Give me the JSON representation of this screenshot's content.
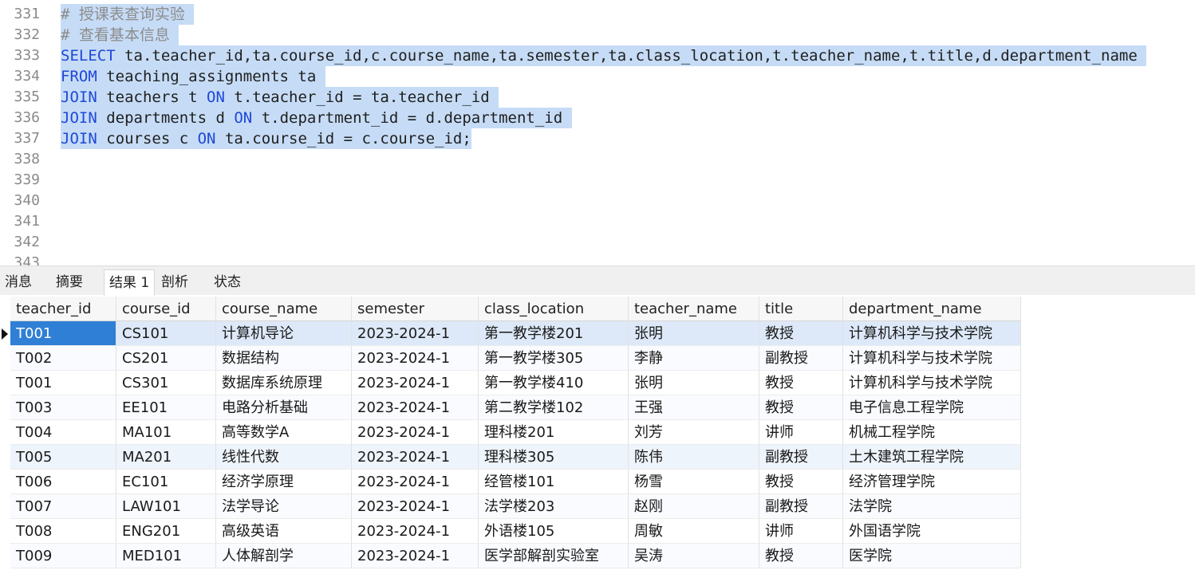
{
  "editor": {
    "lines": [
      {
        "num": "331",
        "segments": [
          {
            "t": "# 授课表查询实验 ",
            "k": "cm"
          }
        ]
      },
      {
        "num": "332",
        "segments": [
          {
            "t": "# 查看基本信息 ",
            "k": "cm"
          }
        ]
      },
      {
        "num": "333",
        "segments": [
          {
            "t": "SELECT",
            "k": "kw"
          },
          {
            "t": " ta.teacher_id,ta.course_id,c.course_name,ta.semester,ta.class_location,t.teacher_name,t.title,d.department_name ",
            "k": ""
          }
        ]
      },
      {
        "num": "334",
        "segments": [
          {
            "t": "FROM",
            "k": "kw"
          },
          {
            "t": " teaching_assignments ta ",
            "k": ""
          }
        ]
      },
      {
        "num": "335",
        "segments": [
          {
            "t": "JOIN",
            "k": "kw"
          },
          {
            "t": " teachers t ",
            "k": ""
          },
          {
            "t": "ON",
            "k": "kw"
          },
          {
            "t": " t.teacher_id = ta.teacher_id ",
            "k": ""
          }
        ]
      },
      {
        "num": "336",
        "segments": [
          {
            "t": "JOIN",
            "k": "kw"
          },
          {
            "t": " departments d ",
            "k": ""
          },
          {
            "t": "ON",
            "k": "kw"
          },
          {
            "t": " t.department_id = d.department_id ",
            "k": ""
          }
        ]
      },
      {
        "num": "337",
        "segments": [
          {
            "t": "JOIN",
            "k": "kw"
          },
          {
            "t": " courses c ",
            "k": ""
          },
          {
            "t": "ON",
            "k": "kw"
          },
          {
            "t": " ta.course_id = c.course_id;",
            "k": ""
          }
        ]
      },
      {
        "num": "338",
        "segments": []
      },
      {
        "num": "339",
        "segments": []
      },
      {
        "num": "340",
        "segments": []
      },
      {
        "num": "341",
        "segments": []
      },
      {
        "num": "342",
        "segments": []
      },
      {
        "num": "343",
        "segments": []
      }
    ]
  },
  "tabs": [
    {
      "label": "消息",
      "active": false
    },
    {
      "label": "摘要",
      "active": false
    },
    {
      "label": "结果 1",
      "active": true
    },
    {
      "label": "剖析",
      "active": false
    },
    {
      "label": "状态",
      "active": false
    }
  ],
  "results": {
    "columns": [
      "teacher_id",
      "course_id",
      "course_name",
      "semester",
      "class_location",
      "teacher_name",
      "title",
      "department_name"
    ],
    "rows": [
      [
        "T001",
        "CS101",
        "计算机导论",
        "2023-2024-1",
        "第一教学楼201",
        "张明",
        "教授",
        "计算机科学与技术学院"
      ],
      [
        "T002",
        "CS201",
        "数据结构",
        "2023-2024-1",
        "第一教学楼305",
        "李静",
        "副教授",
        "计算机科学与技术学院"
      ],
      [
        "T001",
        "CS301",
        "数据库系统原理",
        "2023-2024-1",
        "第一教学楼410",
        "张明",
        "教授",
        "计算机科学与技术学院"
      ],
      [
        "T003",
        "EE101",
        "电路分析基础",
        "2023-2024-1",
        "第二教学楼102",
        "王强",
        "教授",
        "电子信息工程学院"
      ],
      [
        "T004",
        "MA101",
        "高等数学A",
        "2023-2024-1",
        "理科楼201",
        "刘芳",
        "讲师",
        "机械工程学院"
      ],
      [
        "T005",
        "MA201",
        "线性代数",
        "2023-2024-1",
        "理科楼305",
        "陈伟",
        "副教授",
        "土木建筑工程学院"
      ],
      [
        "T006",
        "EC101",
        "经济学原理",
        "2023-2024-1",
        "经管楼101",
        "杨雪",
        "教授",
        "经济管理学院"
      ],
      [
        "T007",
        "LAW101",
        "法学导论",
        "2023-2024-1",
        "法学楼203",
        "赵刚",
        "副教授",
        "法学院"
      ],
      [
        "T008",
        "ENG201",
        "高级英语",
        "2023-2024-1",
        "外语楼105",
        "周敏",
        "讲师",
        "外国语学院"
      ],
      [
        "T009",
        "MED101",
        "人体解剖学",
        "2023-2024-1",
        "医学部解剖实验室",
        "吴涛",
        "教授",
        "医学院"
      ]
    ],
    "selected_row": 0
  },
  "colors": {
    "selection": "#c6dcf6",
    "keyword": "#1f48d8",
    "comment": "#8c8c8c",
    "selected_row": "#dde9f8",
    "selected_cell": "#2f7fd6",
    "hover_row": "#eef4fb",
    "alt_row": "#f9fbfe"
  }
}
